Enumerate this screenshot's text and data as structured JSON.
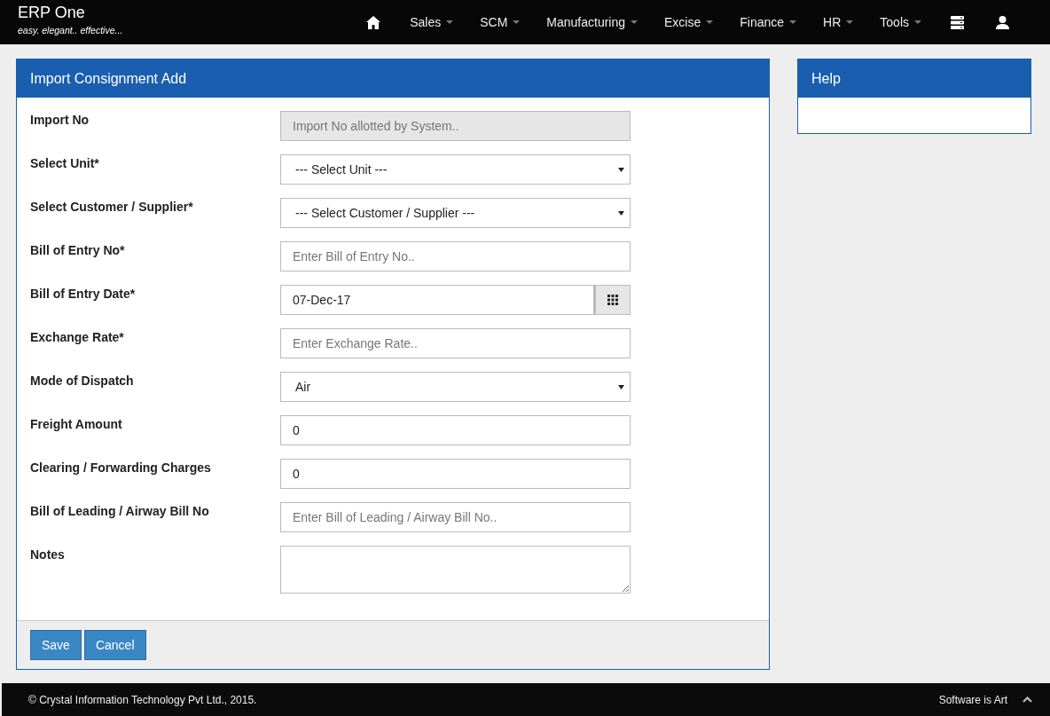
{
  "brand": {
    "title": "ERP One",
    "tagline": "easy. elegant.. effective..."
  },
  "nav": [
    {
      "kind": "home"
    },
    {
      "kind": "menu",
      "label": "Sales",
      "dropdown": true
    },
    {
      "kind": "menu",
      "label": "SCM",
      "dropdown": true
    },
    {
      "kind": "menu",
      "label": "Manufacturing",
      "dropdown": true
    },
    {
      "kind": "menu",
      "label": "Excise",
      "dropdown": true
    },
    {
      "kind": "menu",
      "label": "Finance",
      "dropdown": true
    },
    {
      "kind": "menu",
      "label": "HR",
      "dropdown": true
    },
    {
      "kind": "menu",
      "label": "Tools",
      "dropdown": true
    },
    {
      "kind": "server"
    },
    {
      "kind": "user"
    }
  ],
  "form": {
    "title": "Import Consignment Add",
    "fields": [
      {
        "label": "Import No",
        "kind": "text",
        "disabled": true,
        "placeholder": "Import No allotted by System.."
      },
      {
        "label": "Select Unit*",
        "kind": "select",
        "value": "--- Select Unit ---"
      },
      {
        "label": "Select Customer / Supplier*",
        "kind": "select",
        "value": "--- Select Customer / Supplier ---"
      },
      {
        "label": "Bill of Entry No*",
        "kind": "text",
        "disabled": false,
        "placeholder": "Enter Bill of Entry No.."
      },
      {
        "label": "Bill of Entry Date*",
        "kind": "date",
        "value": "07-Dec-17"
      },
      {
        "label": "Exchange Rate*",
        "kind": "text",
        "disabled": false,
        "placeholder": "Enter Exchange Rate.."
      },
      {
        "label": "Mode of Dispatch",
        "kind": "select",
        "value": "Air"
      },
      {
        "label": "Freight Amount",
        "kind": "text",
        "disabled": false,
        "value": "0"
      },
      {
        "label": "Clearing / Forwarding Charges",
        "kind": "text",
        "disabled": false,
        "value": "0"
      },
      {
        "label": "Bill of Leading / Airway Bill No",
        "kind": "text",
        "disabled": false,
        "placeholder": "Enter Bill of Leading / Airway Bill No.."
      },
      {
        "label": "Notes",
        "kind": "textarea"
      }
    ],
    "buttons": [
      "Save",
      "Cancel"
    ]
  },
  "help": {
    "title": "Help"
  },
  "footer": {
    "copyright": "© Crystal Information Technology Pvt Ltd., 2015.",
    "slogan": "Software is Art"
  }
}
